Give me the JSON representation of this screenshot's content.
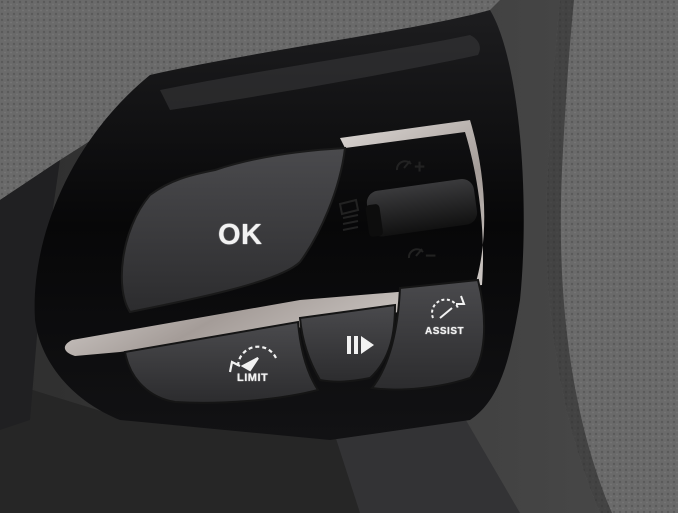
{
  "controls": {
    "ok_label": "OK",
    "limit_label": "LIMIT",
    "assist_label": "ASSIST",
    "speed_plus_label": "+",
    "speed_minus_label": "−"
  },
  "icons": {
    "ok_button": "none",
    "limit_button": "speed-limiter-icon",
    "pause_resume_button": "pause-resume-icon",
    "assist_button": "driving-assist-icon",
    "cruise_stalk": "cruise-control-icon"
  },
  "colors": {
    "button_face": "#3b3b3d",
    "chrome": "#c9c3bf",
    "piano_black": "#0b0b0c",
    "leather": "#6d6d6d",
    "label_text": "#f2f2f2"
  }
}
